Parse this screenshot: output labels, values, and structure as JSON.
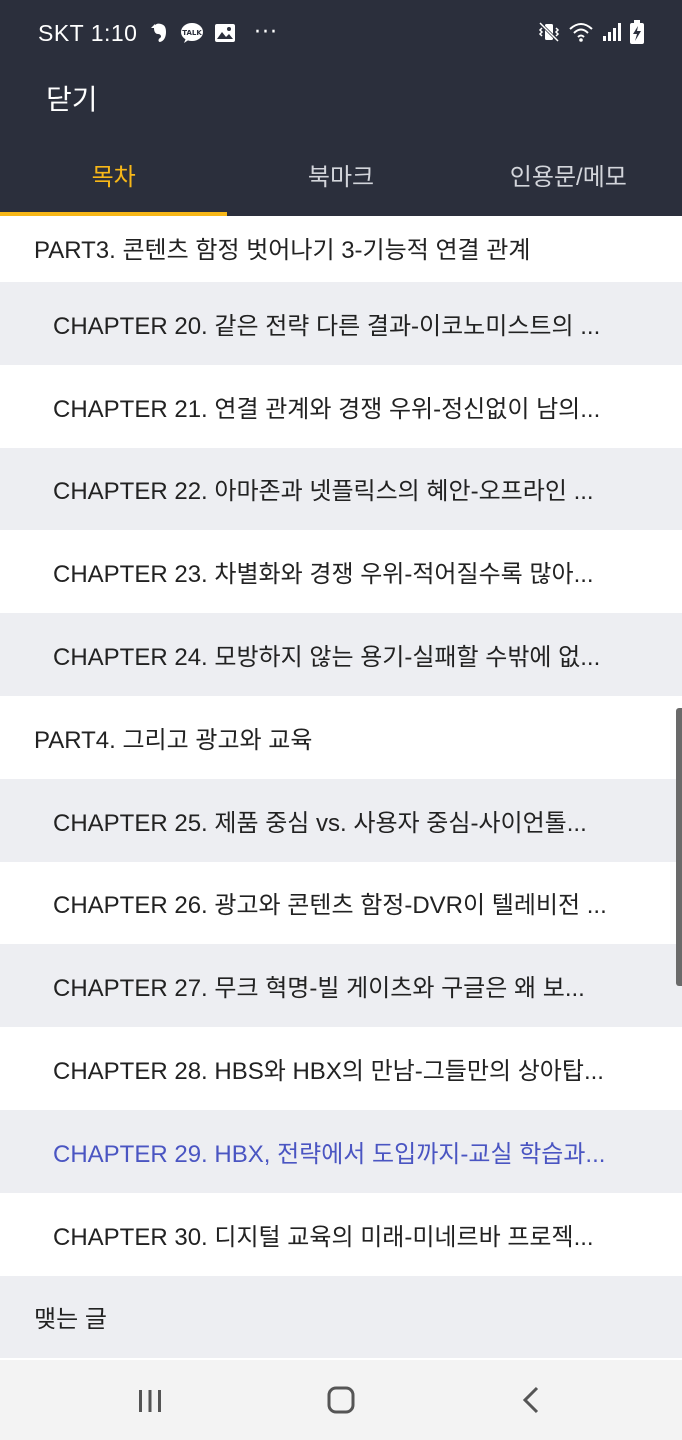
{
  "status_bar": {
    "carrier_time": "SKT 1:10",
    "left_icons": [
      "evernote-icon",
      "kakaotalk-icon",
      "image-icon",
      "more-dots-icon"
    ],
    "kakao_badge": "TALK",
    "more": "···",
    "right_icons": [
      "vibrate-mute-icon",
      "wifi-icon",
      "signal-icon",
      "battery-charging-icon"
    ]
  },
  "header": {
    "close_label": "닫기"
  },
  "tabs": [
    {
      "label": "목차",
      "active": true
    },
    {
      "label": "북마크",
      "active": false
    },
    {
      "label": "인용문/메모",
      "active": false
    }
  ],
  "toc": [
    {
      "type": "part",
      "label": "PART3. 콘텐츠 함정 벗어나기 3-기능적 연결 관계"
    },
    {
      "type": "chapter",
      "label": "CHAPTER 20. 같은 전략 다른 결과-이코노미스트의 ..."
    },
    {
      "type": "chapter",
      "label": "CHAPTER 21. 연결 관계와 경쟁 우위-정신없이 남의..."
    },
    {
      "type": "chapter",
      "label": "CHAPTER 22. 아마존과 넷플릭스의 혜안-오프라인 ..."
    },
    {
      "type": "chapter",
      "label": "CHAPTER 23. 차별화와 경쟁 우위-적어질수록 많아..."
    },
    {
      "type": "chapter",
      "label": "CHAPTER 24. 모방하지 않는 용기-실패할 수밖에 없..."
    },
    {
      "type": "part",
      "label": "PART4. 그리고 광고와 교육"
    },
    {
      "type": "chapter",
      "label": "CHAPTER 25. 제품 중심 vs. 사용자 중심-사이언톨..."
    },
    {
      "type": "chapter",
      "label": "CHAPTER 26. 광고와 콘텐츠 함정-DVR이 텔레비전 ..."
    },
    {
      "type": "chapter",
      "label": "CHAPTER 27. 무크 혁명-빌 게이츠와 구글은 왜 보..."
    },
    {
      "type": "chapter",
      "label": "CHAPTER 28. HBS와 HBX의 만남-그들만의 상아탑..."
    },
    {
      "type": "chapter",
      "label": "CHAPTER 29. HBX, 전략에서 도입까지-교실 학습과...",
      "current": true
    },
    {
      "type": "chapter",
      "label": "CHAPTER 30. 디지털 교육의 미래-미네르바 프로젝..."
    },
    {
      "type": "part",
      "label": "맺는 글"
    }
  ],
  "colors": {
    "header_bg": "#2b2f3c",
    "tab_active": "#f7b718",
    "current_chapter": "#4a55c2",
    "row_shade": "#edeef2"
  },
  "nav_bar": {
    "buttons": [
      "recent-apps-icon",
      "home-icon",
      "back-icon"
    ]
  }
}
